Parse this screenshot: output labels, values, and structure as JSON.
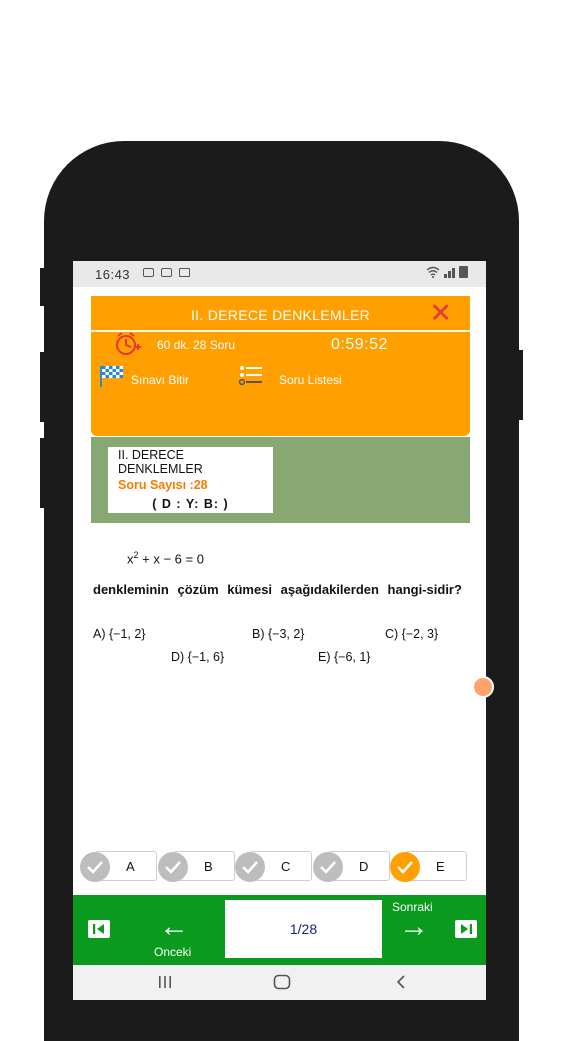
{
  "status_bar": {
    "time": "16:43"
  },
  "header": {
    "title": "II. DERECE DENKLEMLER",
    "exam_info": "60 dk. 28 Soru",
    "timer": "0:59:52",
    "finish_label": "Sınavı Bitir",
    "question_list_label": "Soru Listesi",
    "close_icon": "close-icon",
    "accent_color": "#ffa000",
    "close_color": "#e53935"
  },
  "summary": {
    "title": "II. DERECE DENKLEMLER",
    "question_count": "Soru Sayısı :28",
    "dyb": "( D :  Y:  B: )",
    "bg_color": "#88a873"
  },
  "question": {
    "equation_base": "x",
    "equation_exp": "2",
    "equation_rest": " + x − 6 = 0",
    "text": "denkleminin çözüm kümesi aşağıdakilerden hangi-sidir?",
    "options": {
      "a": "A) {−1, 2}",
      "b": "B) {−3, 2}",
      "c": "C) {−2, 3}",
      "d": "D) {−1, 6}",
      "e": "E) {−6, 1}"
    }
  },
  "answers": {
    "a": "A",
    "b": "B",
    "c": "C",
    "d": "D",
    "e": "E",
    "selected": "E"
  },
  "navigation": {
    "prev_label": "Onceki",
    "next_label": "Sonraki",
    "page": "1/28",
    "bar_color": "#0a9a1e"
  }
}
